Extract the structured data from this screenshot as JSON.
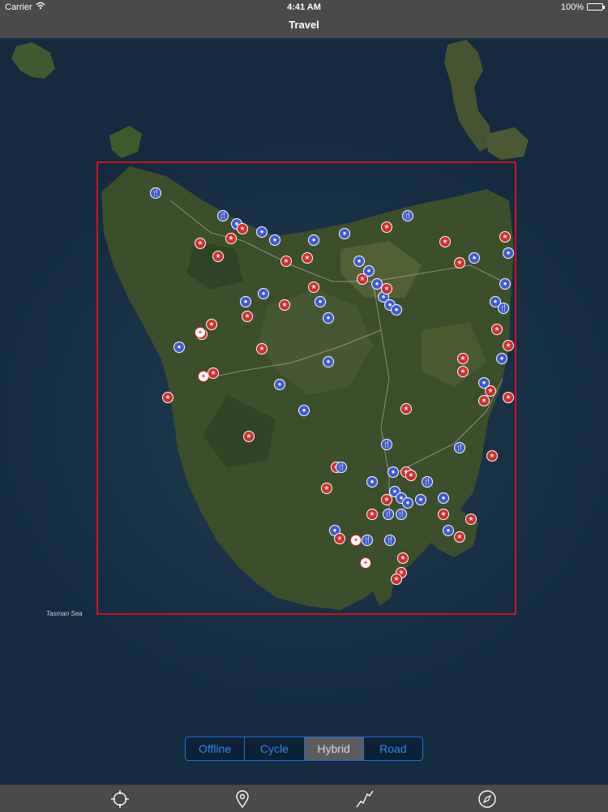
{
  "status_bar": {
    "carrier": "Carrier",
    "time": "4:41 AM",
    "battery": "100%",
    "wifi_icon": "wifi-icon",
    "battery_icon": "battery-icon"
  },
  "nav": {
    "title": "Travel"
  },
  "map": {
    "sea_label": "Tasman Sea",
    "bounds_color": "#d0141c",
    "pin_colors": {
      "attraction": "#d52a2a",
      "service": "#3d5bd8"
    },
    "pin_icons": {
      "attraction": "star-icon",
      "restaurant": "fork-knife-icon",
      "hospital": "plus-icon"
    }
  },
  "map_type": {
    "options": [
      "Offline",
      "Cycle",
      "Hybrid",
      "Road"
    ],
    "selected": "Hybrid"
  },
  "toolbar": {
    "items": [
      "crosshair-icon",
      "location-pin-icon",
      "route-icon",
      "compass-icon"
    ]
  }
}
